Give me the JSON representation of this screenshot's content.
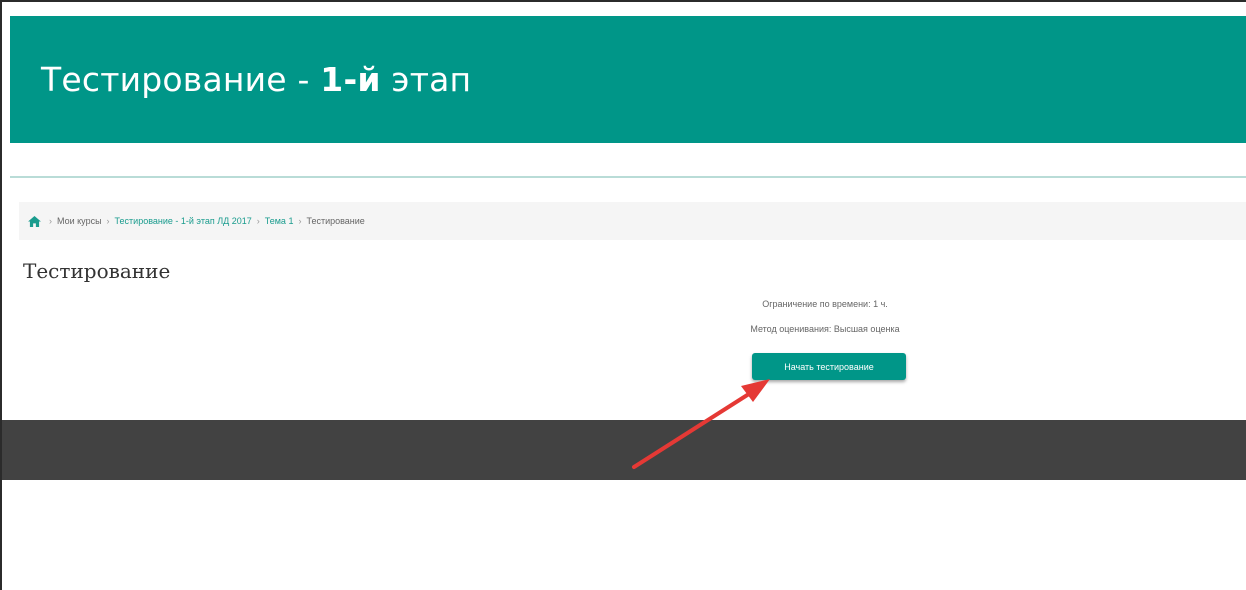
{
  "header": {
    "title_prefix": "Тестирование - ",
    "title_bold": "1-й",
    "title_suffix": " этап"
  },
  "breadcrumb": {
    "home_icon": "home-icon",
    "separator": "›",
    "items": [
      {
        "label": "Мои курсы",
        "link": false
      },
      {
        "label": "Тестирование - 1-й этап ЛД 2017",
        "link": true
      },
      {
        "label": "Тема 1",
        "link": true
      },
      {
        "label": "Тестирование",
        "link": false
      }
    ]
  },
  "main": {
    "page_title": "Тестирование",
    "time_limit": "Ограничение по времени: 1 ч.",
    "grading_method": "Метод оценивания: Высшая оценка",
    "start_button": "Начать тестирование"
  },
  "annotation": {
    "arrow_icon": "red-arrow-icon"
  },
  "colors": {
    "brand": "#009688",
    "footer": "#424242",
    "arrow": "#e53935"
  }
}
